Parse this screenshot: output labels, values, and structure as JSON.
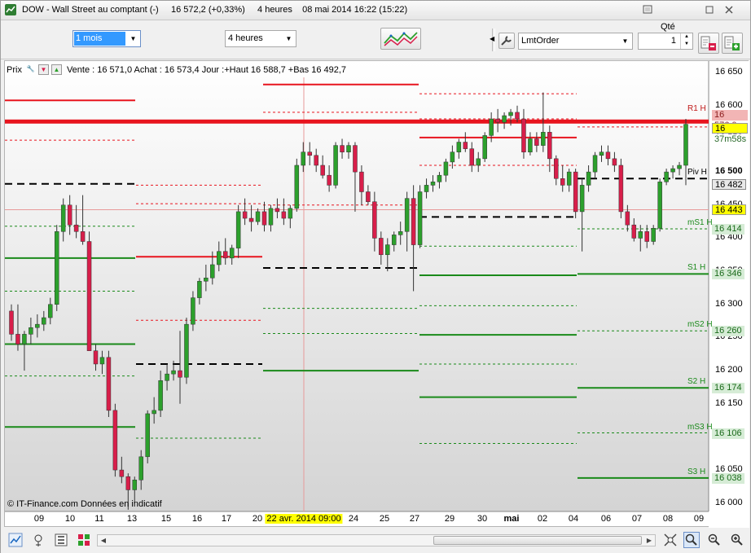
{
  "window": {
    "title": "DOW - Wall Street au comptant (-)     16 572,2 (+0,33%)     4 heures    08 mai 2014 16:22 (15:22)"
  },
  "toolbar": {
    "period_value": "1 mois",
    "timeframe_value": "4 heures",
    "order_type_value": "LmtOrder",
    "qty_label": "Qté",
    "qty_value": "1"
  },
  "info_bar": {
    "label": "Prix",
    "text": "Vente : 16 571,0 Achat : 16 573,4 Jour :+Haut 16 588,7 +Bas 16 492,7"
  },
  "copyright": "© IT-Finance.com  Données en indicatif",
  "chart_data": {
    "type": "candlestick",
    "y_ticks": [
      "16 650",
      "16 600",
      "16 550",
      "16 500",
      "16 450",
      "16 400",
      "16 350",
      "16 300",
      "16 250",
      "16 200",
      "16 150",
      "16 100",
      "16 050",
      "16 000"
    ],
    "ylim": [
      15980,
      16660
    ],
    "x_labels": [
      "09",
      "10",
      "11",
      "13",
      "15",
      "16",
      "17",
      "20",
      "22 avr. 2014 09:00",
      "24",
      "25",
      "27",
      "29",
      "30",
      "mai",
      "02",
      "04",
      "06",
      "07",
      "08",
      "09"
    ],
    "price_tags": {
      "r1_value": "16 576,0",
      "last_price": "16 572,2",
      "countdown": "37m58s",
      "pivot": "16 482",
      "cursor": "16 443",
      "ms1": "16 414",
      "s1": "16 346",
      "ms2": "16 260",
      "s2": "16 174",
      "ms3": "16 106",
      "s3": "16 038"
    },
    "level_labels": {
      "r1": "R1 H",
      "piv": "Piv H",
      "ms1": "mS1 H",
      "s1": "S1 H",
      "ms2": "mS2 H",
      "s2": "S2 H",
      "ms3": "mS3 H",
      "s3": "S3 H"
    },
    "colors": {
      "up": "#2ca02c",
      "down": "#d81e4a",
      "resistance": "#e8141e",
      "support": "#1a8a1a",
      "pivot": "#000000",
      "last": "#ffff00"
    },
    "candles": [
      [
        16290,
        16300,
        16245,
        16255
      ],
      [
        16255,
        16300,
        16230,
        16240
      ],
      [
        16240,
        16260,
        16200,
        16255
      ],
      [
        16255,
        16280,
        16240,
        16265
      ],
      [
        16265,
        16285,
        16250,
        16270
      ],
      [
        16270,
        16290,
        16260,
        16280
      ],
      [
        16280,
        16310,
        16270,
        16300
      ],
      [
        16300,
        16420,
        16290,
        16410
      ],
      [
        16410,
        16460,
        16395,
        16450
      ],
      [
        16450,
        16465,
        16405,
        16420
      ],
      [
        16420,
        16450,
        16400,
        16410
      ],
      [
        16410,
        16465,
        16390,
        16395
      ],
      [
        16395,
        16410,
        16320,
        16230
      ],
      [
        16230,
        16240,
        16200,
        16210
      ],
      [
        16210,
        16230,
        16195,
        16220
      ],
      [
        16220,
        16230,
        16130,
        16140
      ],
      [
        16140,
        16150,
        16040,
        16050
      ],
      [
        16050,
        16070,
        16030,
        16040
      ],
      [
        16040,
        16045,
        15990,
        16020
      ],
      [
        16020,
        16040,
        16000,
        16035
      ],
      [
        16035,
        16080,
        16020,
        16070
      ],
      [
        16070,
        16140,
        16060,
        16135
      ],
      [
        16135,
        16160,
        16120,
        16140
      ],
      [
        16140,
        16200,
        16130,
        16185
      ],
      [
        16185,
        16210,
        16170,
        16195
      ],
      [
        16195,
        16215,
        16185,
        16200
      ],
      [
        16200,
        16260,
        16150,
        16190
      ],
      [
        16190,
        16280,
        16180,
        16270
      ],
      [
        16270,
        16320,
        16260,
        16310
      ],
      [
        16310,
        16340,
        16300,
        16335
      ],
      [
        16335,
        16360,
        16320,
        16340
      ],
      [
        16340,
        16380,
        16330,
        16360
      ],
      [
        16360,
        16395,
        16350,
        16380
      ],
      [
        16380,
        16400,
        16360,
        16370
      ],
      [
        16370,
        16390,
        16360,
        16385
      ],
      [
        16385,
        16450,
        16370,
        16440
      ],
      [
        16440,
        16460,
        16420,
        16430
      ],
      [
        16430,
        16450,
        16410,
        16425
      ],
      [
        16425,
        16445,
        16420,
        16440
      ],
      [
        16440,
        16455,
        16410,
        16420
      ],
      [
        16420,
        16450,
        16410,
        16445
      ],
      [
        16445,
        16460,
        16430,
        16440
      ],
      [
        16440,
        16460,
        16420,
        16430
      ],
      [
        16430,
        16450,
        16415,
        16445
      ],
      [
        16445,
        16520,
        16440,
        16510
      ],
      [
        16510,
        16545,
        16500,
        16530
      ],
      [
        16530,
        16545,
        16510,
        16525
      ],
      [
        16525,
        16535,
        16500,
        16510
      ],
      [
        16510,
        16525,
        16490,
        16495
      ],
      [
        16495,
        16510,
        16470,
        16480
      ],
      [
        16480,
        16545,
        16475,
        16540
      ],
      [
        16540,
        16550,
        16520,
        16530
      ],
      [
        16530,
        16545,
        16520,
        16540
      ],
      [
        16540,
        16545,
        16440,
        16500
      ],
      [
        16500,
        16510,
        16450,
        16470
      ],
      [
        16470,
        16480,
        16450,
        16455
      ],
      [
        16455,
        16470,
        16380,
        16400
      ],
      [
        16400,
        16410,
        16360,
        16375
      ],
      [
        16375,
        16400,
        16350,
        16390
      ],
      [
        16390,
        16410,
        16380,
        16405
      ],
      [
        16405,
        16425,
        16390,
        16410
      ],
      [
        16410,
        16470,
        16380,
        16460
      ],
      [
        16460,
        16480,
        16320,
        16390
      ],
      [
        16390,
        16480,
        16385,
        16470
      ],
      [
        16470,
        16490,
        16460,
        16480
      ],
      [
        16480,
        16495,
        16470,
        16485
      ],
      [
        16485,
        16500,
        16475,
        16495
      ],
      [
        16495,
        16520,
        16485,
        16515
      ],
      [
        16515,
        16540,
        16505,
        16530
      ],
      [
        16530,
        16550,
        16520,
        16545
      ],
      [
        16545,
        16560,
        16530,
        16535
      ],
      [
        16535,
        16545,
        16500,
        16510
      ],
      [
        16510,
        16530,
        16500,
        16520
      ],
      [
        16520,
        16560,
        16515,
        16555
      ],
      [
        16555,
        16590,
        16545,
        16580
      ],
      [
        16580,
        16595,
        16560,
        16575
      ],
      [
        16575,
        16590,
        16565,
        16585
      ],
      [
        16585,
        16595,
        16570,
        16590
      ],
      [
        16590,
        16600,
        16575,
        16580
      ],
      [
        16580,
        16595,
        16520,
        16530
      ],
      [
        16530,
        16560,
        16525,
        16550
      ],
      [
        16550,
        16560,
        16530,
        16540
      ],
      [
        16540,
        16620,
        16530,
        16560
      ],
      [
        16560,
        16570,
        16500,
        16520
      ],
      [
        16520,
        16525,
        16480,
        16490
      ],
      [
        16490,
        16510,
        16470,
        16480
      ],
      [
        16480,
        16505,
        16470,
        16500
      ],
      [
        16500,
        16505,
        16430,
        16440
      ],
      [
        16440,
        16490,
        16380,
        16480
      ],
      [
        16480,
        16510,
        16470,
        16500
      ],
      [
        16500,
        16530,
        16490,
        16525
      ],
      [
        16525,
        16540,
        16515,
        16530
      ],
      [
        16530,
        16540,
        16510,
        16520
      ],
      [
        16520,
        16530,
        16500,
        16510
      ],
      [
        16510,
        16520,
        16430,
        16440
      ],
      [
        16440,
        16450,
        16410,
        16420
      ],
      [
        16420,
        16430,
        16395,
        16400
      ],
      [
        16400,
        16420,
        16380,
        16410
      ],
      [
        16410,
        16420,
        16385,
        16395
      ],
      [
        16395,
        16420,
        16390,
        16415
      ],
      [
        16415,
        16490,
        16410,
        16485
      ],
      [
        16485,
        16505,
        16480,
        16500
      ],
      [
        16500,
        16510,
        16490,
        16505
      ],
      [
        16505,
        16515,
        16495,
        16510
      ],
      [
        16510,
        16580,
        16480,
        16572
      ]
    ]
  }
}
